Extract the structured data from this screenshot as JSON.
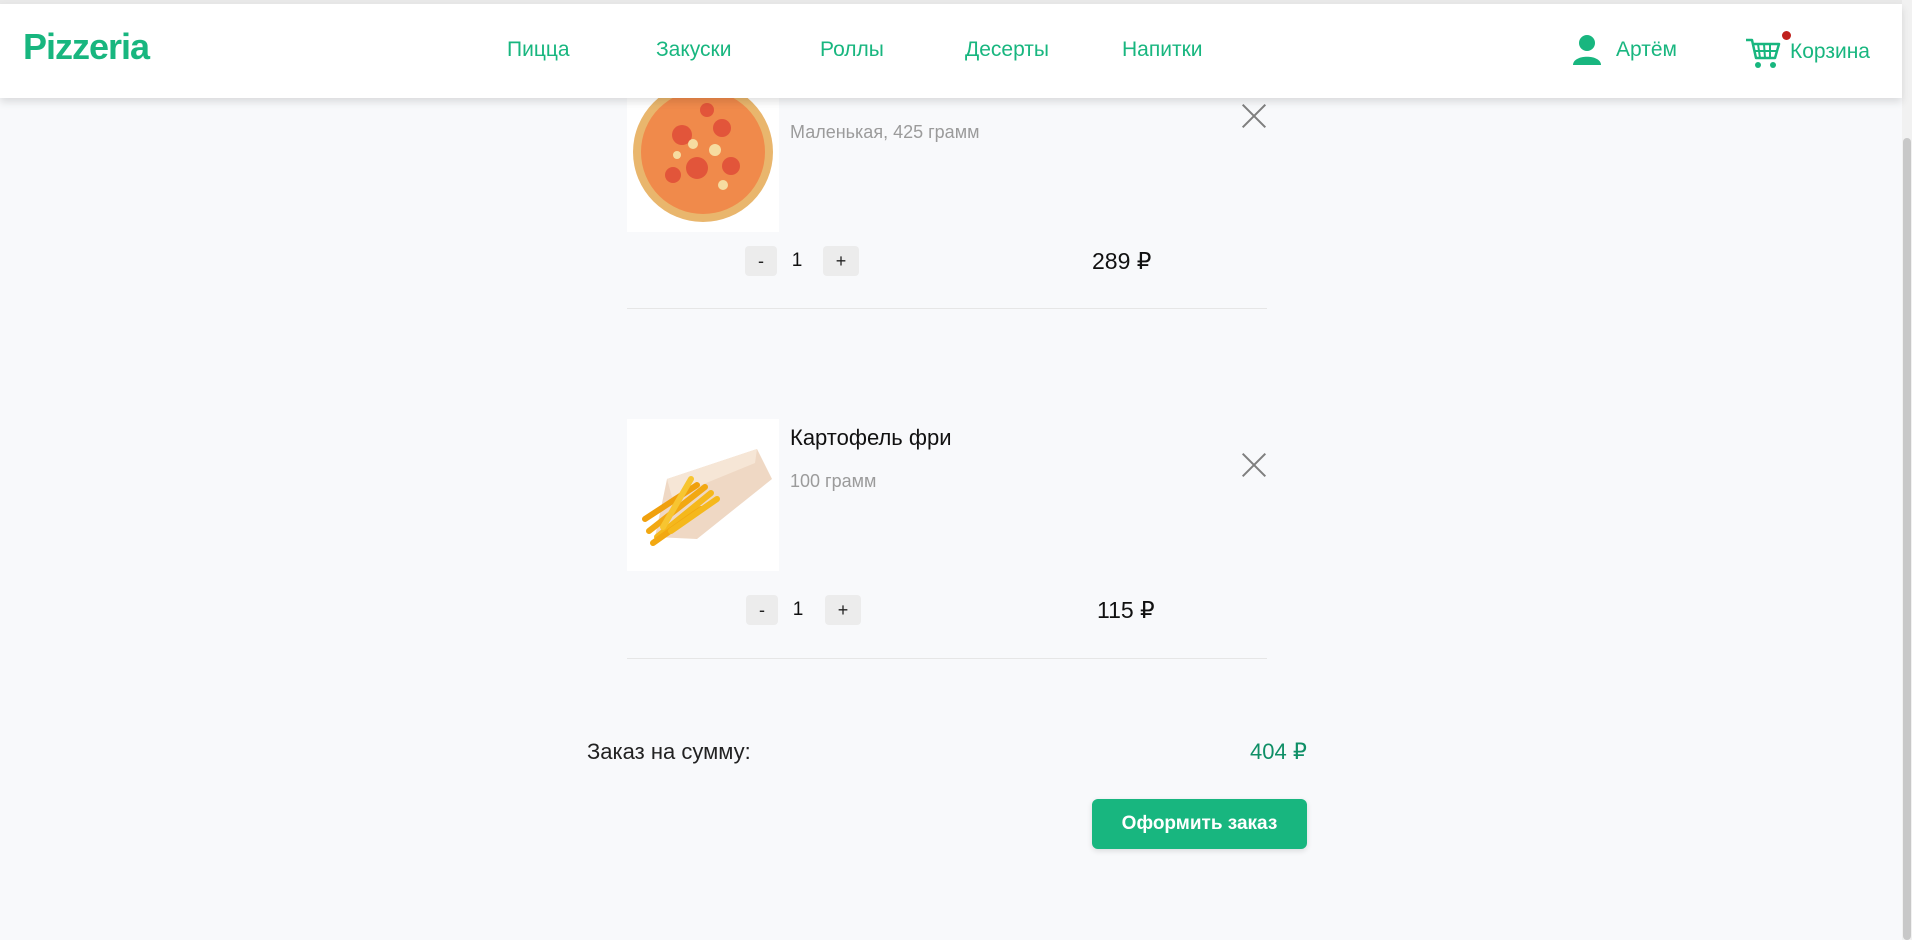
{
  "brand": {
    "logo_text": "Pizzeria",
    "accent_color": "#18b67f",
    "badge_color": "#c0201d"
  },
  "nav": {
    "items": [
      {
        "label": "Пицца"
      },
      {
        "label": "Закуски"
      },
      {
        "label": "Роллы"
      },
      {
        "label": "Десерты"
      },
      {
        "label": "Напитки"
      }
    ]
  },
  "header": {
    "user_icon": "user-icon",
    "user_name": "Артём",
    "cart_icon": "cart-icon",
    "cart_label": "Корзина"
  },
  "cart": {
    "items": [
      {
        "title": "",
        "subtitle": "Маленькая, 425 грамм",
        "quantity": "1",
        "minus": "-",
        "plus": "+",
        "price": "289 ₽"
      },
      {
        "title": "Картофель фри",
        "subtitle": "100 грамм",
        "quantity": "1",
        "minus": "-",
        "plus": "+",
        "price": "115 ₽"
      }
    ],
    "total_label": "Заказ на сумму:",
    "total_value": "404 ₽",
    "order_button": "Оформить заказ"
  }
}
